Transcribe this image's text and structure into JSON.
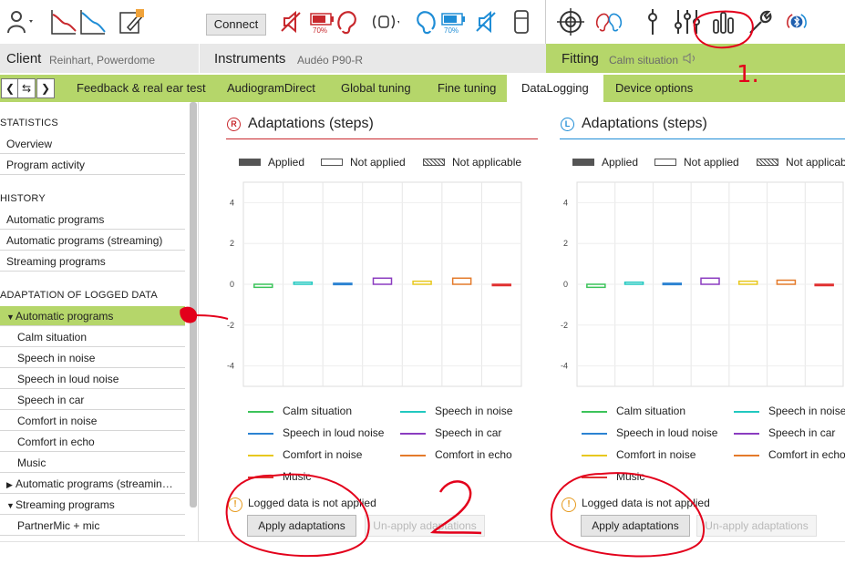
{
  "toolbar": {
    "connect_label": "Connect",
    "left_battery": "70%",
    "right_battery": "70%",
    "icons": [
      "client-icon",
      "audiogram-icon",
      "audiogram-compare-icon",
      "notes-icon",
      "mute-icon",
      "battery-icon",
      "ear-icon",
      "streaming-icon",
      "ear-icon",
      "battery-icon",
      "mute-icon",
      "phone-icon",
      "target-icon",
      "ears-icon",
      "tuning-icon",
      "sliders-icon",
      "datalogging-icon",
      "wrench-icon",
      "bluetooth-icon"
    ]
  },
  "header": {
    "client_title": "Client",
    "client_name": "Reinhart, Powerdome",
    "instruments_title": "Instruments",
    "instruments_model": "Audéo P90-R",
    "fitting_title": "Fitting",
    "fitting_program": "Calm situation"
  },
  "tabs": {
    "items": [
      "Feedback & real ear test",
      "AudiogramDirect",
      "Global tuning",
      "Fine tuning",
      "DataLogging",
      "Device options"
    ],
    "active": "DataLogging"
  },
  "sidebar": {
    "statistics_heading": "STATISTICS",
    "statistics_items": [
      "Overview",
      "Program activity"
    ],
    "history_heading": "HISTORY",
    "history_items": [
      "Automatic programs",
      "Automatic programs (streaming)",
      "Streaming programs"
    ],
    "adaptation_heading": "ADAPTATION OF LOGGED DATA",
    "adaptation_group": "Automatic programs",
    "adaptation_children": [
      "Calm situation",
      "Speech in noise",
      "Speech in loud noise",
      "Speech in car",
      "Comfort in noise",
      "Comfort in echo",
      "Music"
    ],
    "streaming_auto_group": "Automatic programs (streamin…",
    "streaming_group": "Streaming programs",
    "streaming_children": [
      "PartnerMic + mic"
    ]
  },
  "panels": {
    "right": {
      "badge": "R",
      "title": "Adaptations (steps)",
      "warning": "Logged data is not applied",
      "apply_label": "Apply adaptations",
      "unapply_label": "Un-apply adaptations",
      "legend_applied": "Applied",
      "legend_not_applied": "Not applied",
      "legend_not_applicable": "Not applicable"
    },
    "left": {
      "badge": "L",
      "title": "Adaptations (steps)",
      "warning": "Logged data is not applied",
      "apply_label": "Apply adaptations",
      "unapply_label": "Un-apply adaptations",
      "legend_applied": "Applied",
      "legend_not_applied": "Not applied",
      "legend_not_applicable": "Not applicable"
    }
  },
  "colors": {
    "accent_green": "#b5d66a",
    "right_side": "#c8282d",
    "left_side": "#1f8dd6",
    "annotation": "#e3001b"
  },
  "annotations": {
    "label_1": "1.",
    "label_2": "2"
  },
  "chart_data": [
    {
      "type": "bar",
      "side": "right",
      "yticks": [
        "4",
        "2",
        "0",
        "-2",
        "-4"
      ],
      "ylim": [
        -5,
        5
      ],
      "series": [
        {
          "name": "Calm situation",
          "color": "#3cc35a",
          "value": -0.15
        },
        {
          "name": "Speech in noise",
          "color": "#21c8c0",
          "value": 0.1
        },
        {
          "name": "Speech in loud noise",
          "color": "#2c83d2",
          "value": 0.05
        },
        {
          "name": "Speech in car",
          "color": "#8b3cc0",
          "value": 0.3
        },
        {
          "name": "Comfort in noise",
          "color": "#e8c81e",
          "value": 0.15
        },
        {
          "name": "Comfort in echo",
          "color": "#e47a2a",
          "value": 0.3
        },
        {
          "name": "Music",
          "color": "#e03030",
          "value": -0.05
        }
      ]
    },
    {
      "type": "bar",
      "side": "left",
      "yticks": [
        "4",
        "2",
        "0",
        "-2",
        "-4"
      ],
      "ylim": [
        -5,
        5
      ],
      "series": [
        {
          "name": "Calm situation",
          "color": "#3cc35a",
          "value": -0.15
        },
        {
          "name": "Speech in noise",
          "color": "#21c8c0",
          "value": 0.1
        },
        {
          "name": "Speech in loud noise",
          "color": "#2c83d2",
          "value": 0.05
        },
        {
          "name": "Speech in car",
          "color": "#8b3cc0",
          "value": 0.3
        },
        {
          "name": "Comfort in noise",
          "color": "#e8c81e",
          "value": 0.15
        },
        {
          "name": "Comfort in echo",
          "color": "#e47a2a",
          "value": 0.2
        },
        {
          "name": "Music",
          "color": "#e03030",
          "value": -0.05
        }
      ]
    }
  ]
}
